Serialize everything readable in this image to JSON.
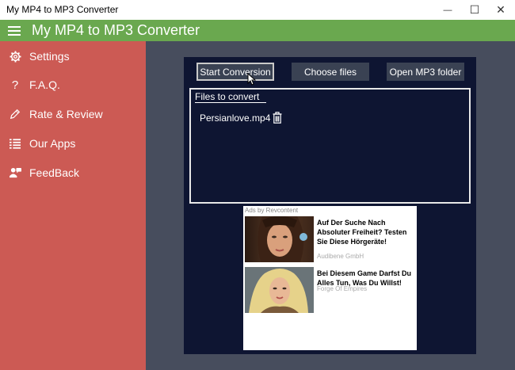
{
  "window": {
    "title": "My MP4 to MP3 Converter",
    "minimize_glyph": "—",
    "maximize_glyph": "☐",
    "close_glyph": "✕"
  },
  "appbar": {
    "title": "My MP4 to MP3 Converter",
    "accent": "#6aa84f"
  },
  "sidebar": {
    "background": "#cc5a54",
    "items": [
      {
        "label": "Settings",
        "icon": "gear-icon"
      },
      {
        "label": "F.A.Q.",
        "icon": "question-icon"
      },
      {
        "label": "Rate & Review",
        "icon": "pencil-icon"
      },
      {
        "label": "Our Apps",
        "icon": "list-icon"
      },
      {
        "label": "FeedBack",
        "icon": "people-icon"
      }
    ]
  },
  "toolbar": {
    "start_label": "Start Conversion",
    "choose_label": "Choose files",
    "open_label": "Open MP3 folder"
  },
  "files": {
    "title": "Files to convert",
    "items": [
      {
        "name": "Persianlove.mp4",
        "icon": "trash-icon"
      }
    ]
  },
  "ads": {
    "header": "Ads by Revcontent",
    "items": [
      {
        "headline": "Auf Der Suche Nach Absoluter Freiheit? Testen Sie Diese Hörgeräte!",
        "sponsor": "Audibene GmbH"
      },
      {
        "headline": "Bei Diesem Game Darfst Du Alles Tun, Was Du Willst!",
        "sponsor": "Forge Of Empires"
      }
    ]
  }
}
